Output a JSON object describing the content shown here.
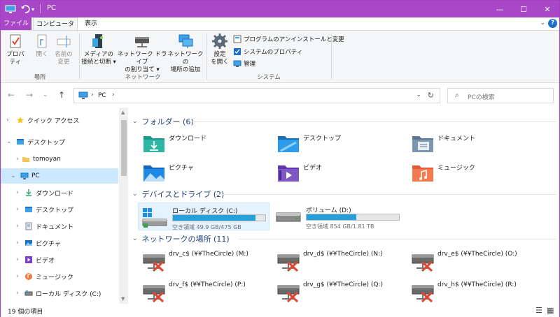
{
  "window": {
    "title": "PC",
    "quick_access_sep": "|",
    "controls": {
      "minimize": "—",
      "maximize": "☐",
      "close": "✕"
    }
  },
  "ribbon_tabs": {
    "file": "ファイル",
    "computer": "コンピューター",
    "view": "表示",
    "collapse": "⌄",
    "help": "?"
  },
  "ribbon": {
    "location": {
      "label": "場所",
      "properties": "プロパティ",
      "open": "開く",
      "rename_line1": "名前の",
      "rename_line2": "変更"
    },
    "network": {
      "label": "ネットワーク",
      "media_line1": "メディアの",
      "media_line2": "接続と切断 ▾",
      "map_line1": "ネットワーク ドライブ",
      "map_line2": "の割り当て ▾",
      "add_line1": "ネットワークの",
      "add_line2": "場所の追加"
    },
    "system": {
      "label": "システム",
      "settings_line1": "設定",
      "settings_line2": "を開く",
      "uninstall": "プログラムのアンインストールと変更",
      "system_properties": "システムのプロパティ",
      "manage": "管理"
    }
  },
  "address_bar": {
    "back": "←",
    "forward": "→",
    "recent": "⌄",
    "up": "↑",
    "crumb_arrow": "›",
    "crumb": "PC",
    "dropdown": "⌄",
    "refresh": "↻",
    "search_placeholder": "PCの検索",
    "search_icon": "⌕"
  },
  "nav_pane": {
    "items": [
      {
        "label": "クイック アクセス",
        "expander": "›",
        "icon": "star-icon"
      },
      {
        "label": "デスクトップ",
        "expander": "⌄",
        "icon": "desktop-folder-icon"
      },
      {
        "label": "tomoyan",
        "expander": "›",
        "icon": "user-folder-icon"
      },
      {
        "label": "PC",
        "expander": "⌄",
        "icon": "pc-icon"
      },
      {
        "label": "ダウンロード",
        "expander": "›",
        "icon": "download-icon"
      },
      {
        "label": "デスクトップ",
        "expander": "›",
        "icon": "desktop-icon"
      },
      {
        "label": "ドキュメント",
        "expander": "›",
        "icon": "document-icon"
      },
      {
        "label": "ピクチャ",
        "expander": "›",
        "icon": "pictures-icon"
      },
      {
        "label": "ビデオ",
        "expander": "›",
        "icon": "video-icon"
      },
      {
        "label": "ミュージック",
        "expander": "›",
        "icon": "music-icon"
      },
      {
        "label": "ローカル ディスク (C:)",
        "expander": "›",
        "icon": "drive-icon"
      }
    ]
  },
  "content": {
    "folders_header": "フォルダー (6)",
    "folders": [
      {
        "name": "ダウンロード",
        "icon": "download-folder-icon"
      },
      {
        "name": "デスクトップ",
        "icon": "desktop-folder-icon"
      },
      {
        "name": "ドキュメント",
        "icon": "documents-folder-icon"
      },
      {
        "name": "ピクチャ",
        "icon": "pictures-folder-icon"
      },
      {
        "name": "ビデオ",
        "icon": "videos-folder-icon"
      },
      {
        "name": "ミュージック",
        "icon": "music-folder-icon"
      }
    ],
    "drives_header": "デバイスとドライブ (2)",
    "drives": [
      {
        "name": "ローカル ディスク (C:)",
        "space": "空き領域 49.9 GB/475 GB",
        "used_fraction": 0.895
      },
      {
        "name": "ボリューム (D:)",
        "space": "空き領域 854 GB/1.81 TB",
        "used_fraction": 0.54
      }
    ],
    "network_header": "ネットワークの場所 (11)",
    "network": [
      {
        "name": "drv_c$ (¥¥TheCircle) (M:)"
      },
      {
        "name": "drv_d$ (¥¥TheCircle) (N:)"
      },
      {
        "name": "drv_e$ (¥¥TheCircle) (O:)"
      },
      {
        "name": "drv_f$ (¥¥TheCircle) (P:)"
      },
      {
        "name": "drv_g$ (¥¥TheCircle) (Q:)"
      },
      {
        "name": "drv_h$ (¥¥TheCircle) (R:)"
      }
    ],
    "section_chevron": "⌄"
  },
  "status_bar": {
    "count": "19 個の項目",
    "details_view": "☰",
    "tiles_view": "▦"
  },
  "colors": {
    "accent": "#a947c9",
    "selection": "#cce8ff",
    "drive_bar": "#26a0da"
  }
}
